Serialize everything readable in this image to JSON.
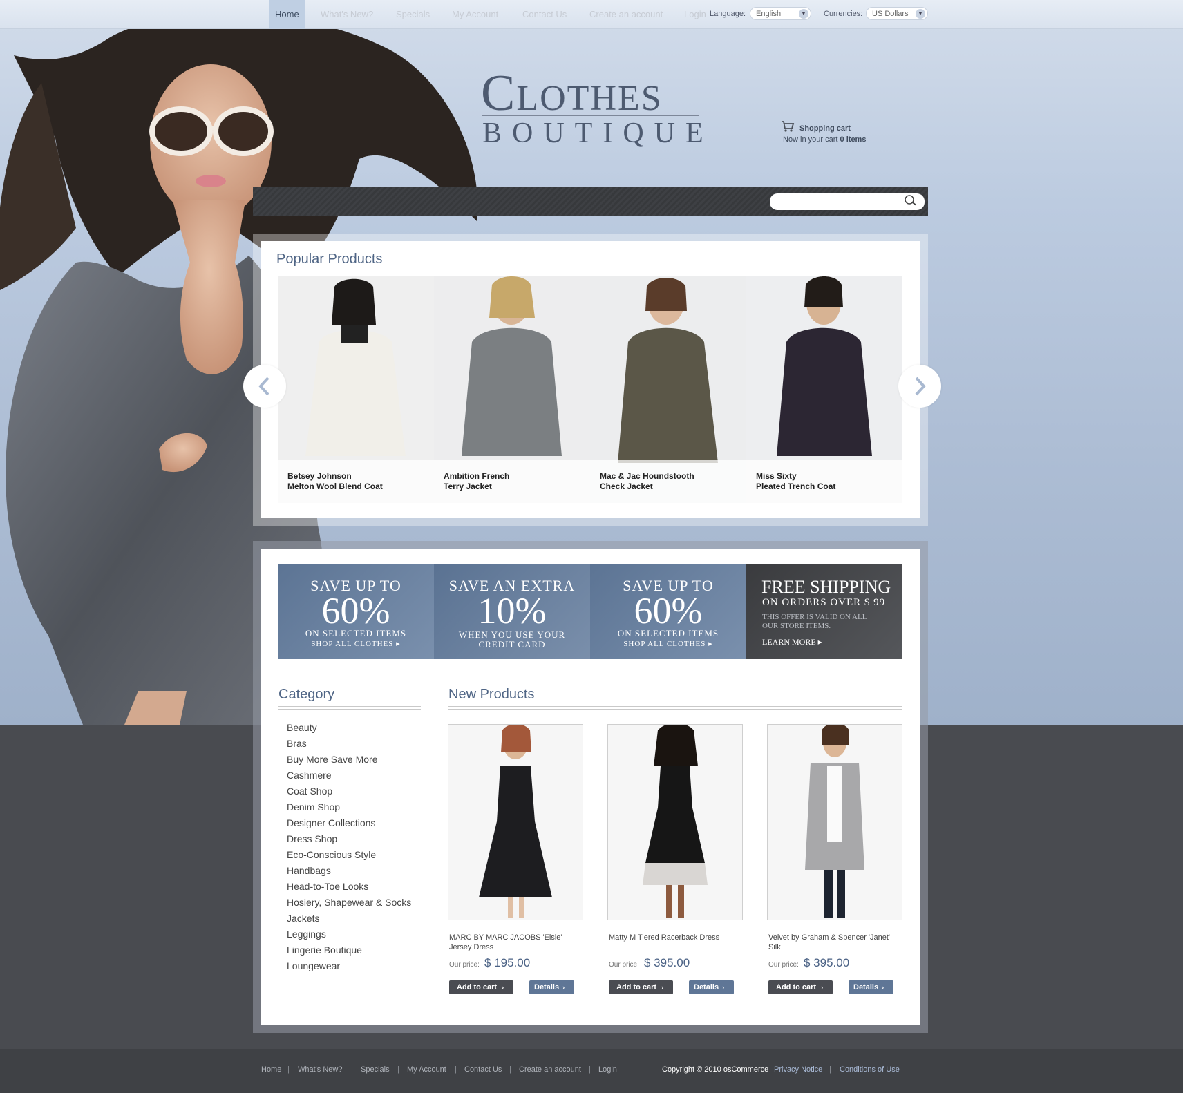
{
  "topbar": {
    "language_label": "Language:",
    "language_value": "English",
    "currencies_label": "Currencies:",
    "currencies_value": "US Dollars"
  },
  "logo": {
    "line1": "Clothes",
    "line2": "BOUTIQUE"
  },
  "cart": {
    "title": "Shopping cart",
    "line_prefix": "Now in your cart",
    "count": "0 items"
  },
  "nav": {
    "items": [
      "Home",
      "What's New?",
      "Specials",
      "My Account",
      "Contact Us",
      "Create an account",
      "Login"
    ],
    "search_placeholder": ""
  },
  "popular": {
    "title": "Popular Products",
    "products": [
      {
        "line1": "Betsey Johnson",
        "line2": "Melton Wool Blend Coat"
      },
      {
        "line1": "Ambition French",
        "line2": "Terry Jacket"
      },
      {
        "line1": "Mac & Jac Houndstooth",
        "line2": "Check Jacket"
      },
      {
        "line1": "Miss Sixty",
        "line2": "Pleated Trench Coat"
      }
    ]
  },
  "banners": [
    {
      "l1": "SAVE UP TO",
      "l2": "60%",
      "l3": "ON SELECTED ITEMS",
      "l4": "SHOP ALL CLOTHES ▸"
    },
    {
      "l1": "SAVE AN EXTRA",
      "l2": "10%",
      "l3": "WHEN YOU USE YOUR",
      "l4": "CREDIT CARD"
    },
    {
      "l1": "SAVE UP TO",
      "l2": "60%",
      "l3": "ON SELECTED ITEMS",
      "l4": "SHOP ALL CLOTHES ▸"
    },
    {
      "l1": "FREE SHIPPING",
      "l2": "ON ORDERS OVER $ 99",
      "l3": "THIS OFFER IS VALID ON ALL",
      "l4": "OUR STORE ITEMS.",
      "l5": "LEARN MORE ▸"
    }
  ],
  "category": {
    "title": "Category",
    "items": [
      "Beauty",
      "Bras",
      "Buy More Save More",
      "Cashmere",
      "Coat Shop",
      "Denim Shop",
      "Designer Collections",
      "Dress Shop",
      "Eco-Conscious Style",
      "Handbags",
      "Head-to-Toe Looks",
      "Hosiery, Shapewear & Socks",
      "Jackets",
      "Leggings",
      "Lingerie Boutique",
      "Loungewear"
    ]
  },
  "new_products": {
    "title": "New Products",
    "price_label": "Our price:",
    "add_label": "Add to cart",
    "details_label": "Details",
    "products": [
      {
        "title": "MARC BY MARC JACOBS 'Elsie' Jersey Dress",
        "price": "$ 195.00"
      },
      {
        "title": "Matty M Tiered Racerback Dress",
        "price": "$ 395.00"
      },
      {
        "title": "Velvet by Graham & Spencer 'Janet' Silk",
        "price": "$ 395.00"
      }
    ]
  },
  "footer": {
    "links": [
      "Home",
      "What's New?",
      "Specials",
      "My Account",
      "Contact Us",
      "Create an account",
      "Login"
    ],
    "copyright": "Copyright © 2010 osCommerce",
    "privacy": "Privacy Notice",
    "conditions": "Conditions of Use"
  }
}
